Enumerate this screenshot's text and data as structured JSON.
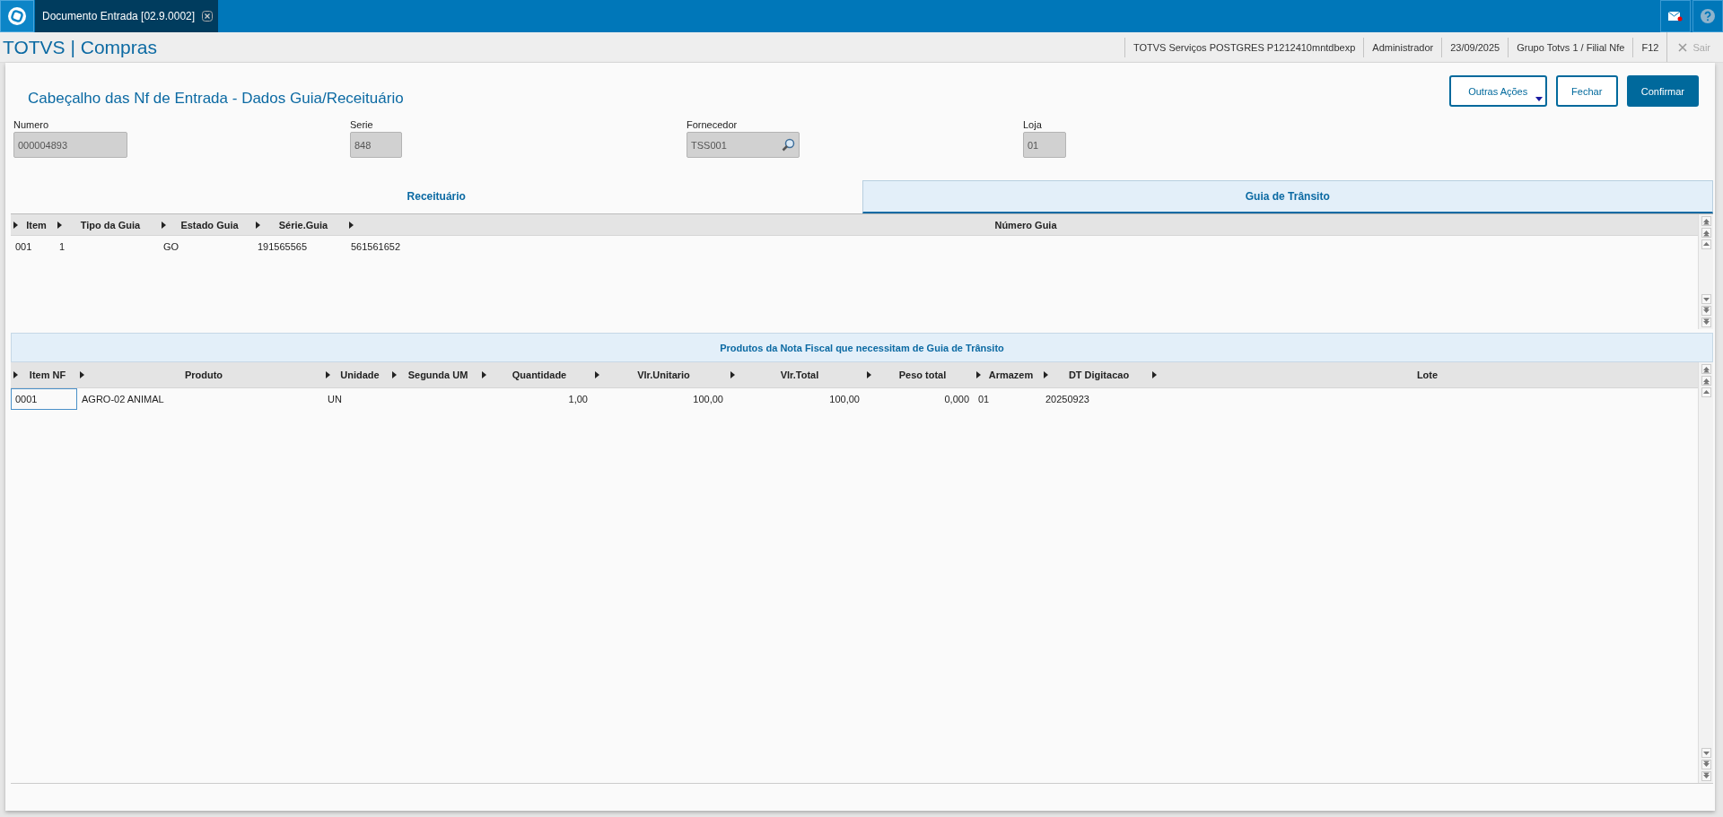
{
  "app_tabs": [
    {
      "label": "Documento Entrada [02.9.0002]",
      "selected": true
    }
  ],
  "app_title": "TOTVS | Compras",
  "status_items": [
    "TOTVS Serviços POSTGRES P1212410mntdbexp",
    "Administrador",
    "23/09/2025",
    "Grupo Totvs 1 / Filial Nfe",
    "F12"
  ],
  "exit": {
    "label": "Sair",
    "disabled": true
  },
  "page_title": "Cabeçalho das Nf de Entrada - Dados Guia/Receituário",
  "actions": [
    {
      "label": "Outras Ações",
      "kind": "menu"
    },
    {
      "label": "Fechar",
      "kind": "outline"
    },
    {
      "label": "Confirmar",
      "kind": "primary"
    }
  ],
  "fields": [
    {
      "label": "Numero",
      "value": "000004893",
      "kind": "text"
    },
    {
      "label": "Serie",
      "value": "848",
      "kind": "text"
    },
    {
      "label": "Fornecedor",
      "value": "TSS001",
      "kind": "lookup"
    },
    {
      "label": "Loja",
      "value": "01",
      "kind": "text"
    }
  ],
  "tabs": [
    {
      "label": "Receituário",
      "selected": false
    },
    {
      "label": "Guia de Trânsito",
      "selected": true
    }
  ],
  "guia_table": {
    "columns": [
      "Item",
      "Tipo da Guia",
      "Estado Guia",
      "Série.Guia",
      "Número Guia"
    ],
    "rows": [
      {
        "cells": [
          "001",
          "1",
          "GO",
          "191565565",
          "561561652"
        ],
        "selected": false
      }
    ]
  },
  "products_section": {
    "title": "Produtos da Nota Fiscal que necessitam de Guia de Trânsito",
    "columns": [
      "Item NF",
      "Produto",
      "Unidade",
      "Segunda UM",
      "Quantidade",
      "Vlr.Unitario",
      "Vlr.Total",
      "Peso total",
      "Armazem",
      "DT Digitacao",
      "Lote"
    ],
    "rows": [
      {
        "cells": [
          "0001",
          "AGRO-02 ANIMAL",
          "UN",
          "",
          "1,00",
          "100,00",
          "100,00",
          "0,000",
          "01",
          "20250923",
          ""
        ],
        "selected": true
      }
    ]
  }
}
